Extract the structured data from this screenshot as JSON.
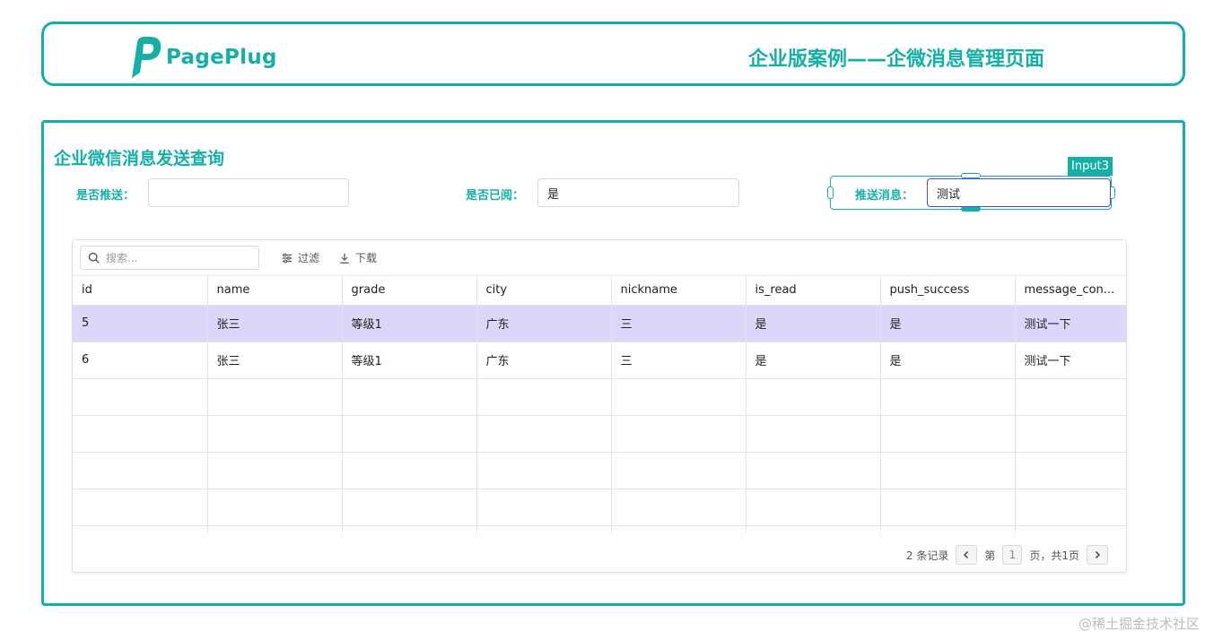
{
  "header": {
    "logo_text": "PagePlug",
    "title": "企业版案例——企微消息管理页面"
  },
  "colors": {
    "brand": "#14b0a6",
    "selected_row": "#dcd7f8"
  },
  "section": {
    "title": "企业微信消息发送查询"
  },
  "filters": {
    "is_pushed": {
      "label": "是否推送：",
      "value": ""
    },
    "is_read": {
      "label": "是否已阅：",
      "value": "是"
    },
    "push_message": {
      "label": "推送消息：",
      "value": "测试",
      "widget_name": "Input3"
    }
  },
  "table": {
    "search_placeholder": "搜索...",
    "filter_label": "过滤",
    "download_label": "下载",
    "columns": [
      "id",
      "name",
      "grade",
      "city",
      "nickname",
      "is_read",
      "push_success",
      "message_con..."
    ],
    "rows": [
      [
        "5",
        "张三",
        "等级1",
        "广东",
        "三",
        "是",
        "是",
        "测试一下"
      ],
      [
        "6",
        "张三",
        "等级1",
        "广东",
        "三",
        "是",
        "是",
        "测试一下"
      ]
    ],
    "selected_row_index": 0,
    "empty_rows": 4
  },
  "pagination": {
    "records_text": "2 条记录",
    "page_prefix": "第",
    "page_number": "1",
    "page_suffix": "页，共1页"
  },
  "watermark": "@稀土掘金技术社区"
}
